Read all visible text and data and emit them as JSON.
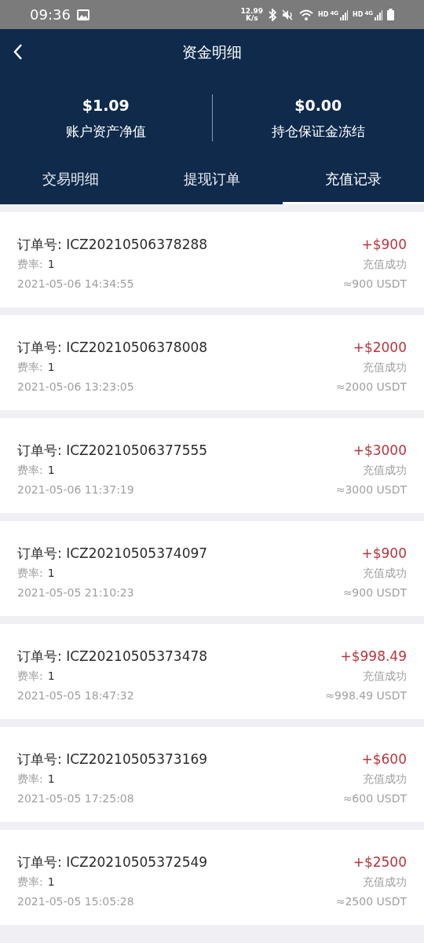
{
  "status_bar": {
    "time": "09:36",
    "speed": "12.99",
    "speed_unit": "K/s",
    "hd": [
      "HD",
      "HD"
    ],
    "net": [
      "4G",
      "4G"
    ]
  },
  "header": {
    "title": "资金明细"
  },
  "summary": [
    {
      "value": "$1.09",
      "label": "账户资产净值"
    },
    {
      "value": "$0.00",
      "label": "持仓保证金冻结"
    }
  ],
  "tabs": [
    {
      "label": "交易明细",
      "selected": false
    },
    {
      "label": "提现订单",
      "selected": false
    },
    {
      "label": "充值记录",
      "selected": true
    }
  ],
  "records": [
    {
      "order": "订单号: ICZ20210506378288",
      "rate_label": "费率:",
      "rate": "1",
      "time": "2021-05-06 14:34:55",
      "amount": "+$900",
      "status": "充值成功",
      "usdt": "≈900 USDT"
    },
    {
      "order": "订单号: ICZ20210506378008",
      "rate_label": "费率:",
      "rate": "1",
      "time": "2021-05-06 13:23:05",
      "amount": "+$2000",
      "status": "充值成功",
      "usdt": "≈2000 USDT"
    },
    {
      "order": "订单号: ICZ20210506377555",
      "rate_label": "费率:",
      "rate": "1",
      "time": "2021-05-06 11:37:19",
      "amount": "+$3000",
      "status": "充值成功",
      "usdt": "≈3000 USDT"
    },
    {
      "order": "订单号: ICZ20210505374097",
      "rate_label": "费率:",
      "rate": "1",
      "time": "2021-05-05 21:10:23",
      "amount": "+$900",
      "status": "充值成功",
      "usdt": "≈900 USDT"
    },
    {
      "order": "订单号: ICZ20210505373478",
      "rate_label": "费率:",
      "rate": "1",
      "time": "2021-05-05 18:47:32",
      "amount": "+$998.49",
      "status": "充值成功",
      "usdt": "≈998.49 USDT"
    },
    {
      "order": "订单号: ICZ20210505373169",
      "rate_label": "费率:",
      "rate": "1",
      "time": "2021-05-05 17:25:08",
      "amount": "+$600",
      "status": "充值成功",
      "usdt": "≈600 USDT"
    },
    {
      "order": "订单号: ICZ20210505372549",
      "rate_label": "费率:",
      "rate": "1",
      "time": "2021-05-05 15:05:28",
      "amount": "+$2500",
      "status": "充值成功",
      "usdt": "≈2500 USDT"
    }
  ]
}
